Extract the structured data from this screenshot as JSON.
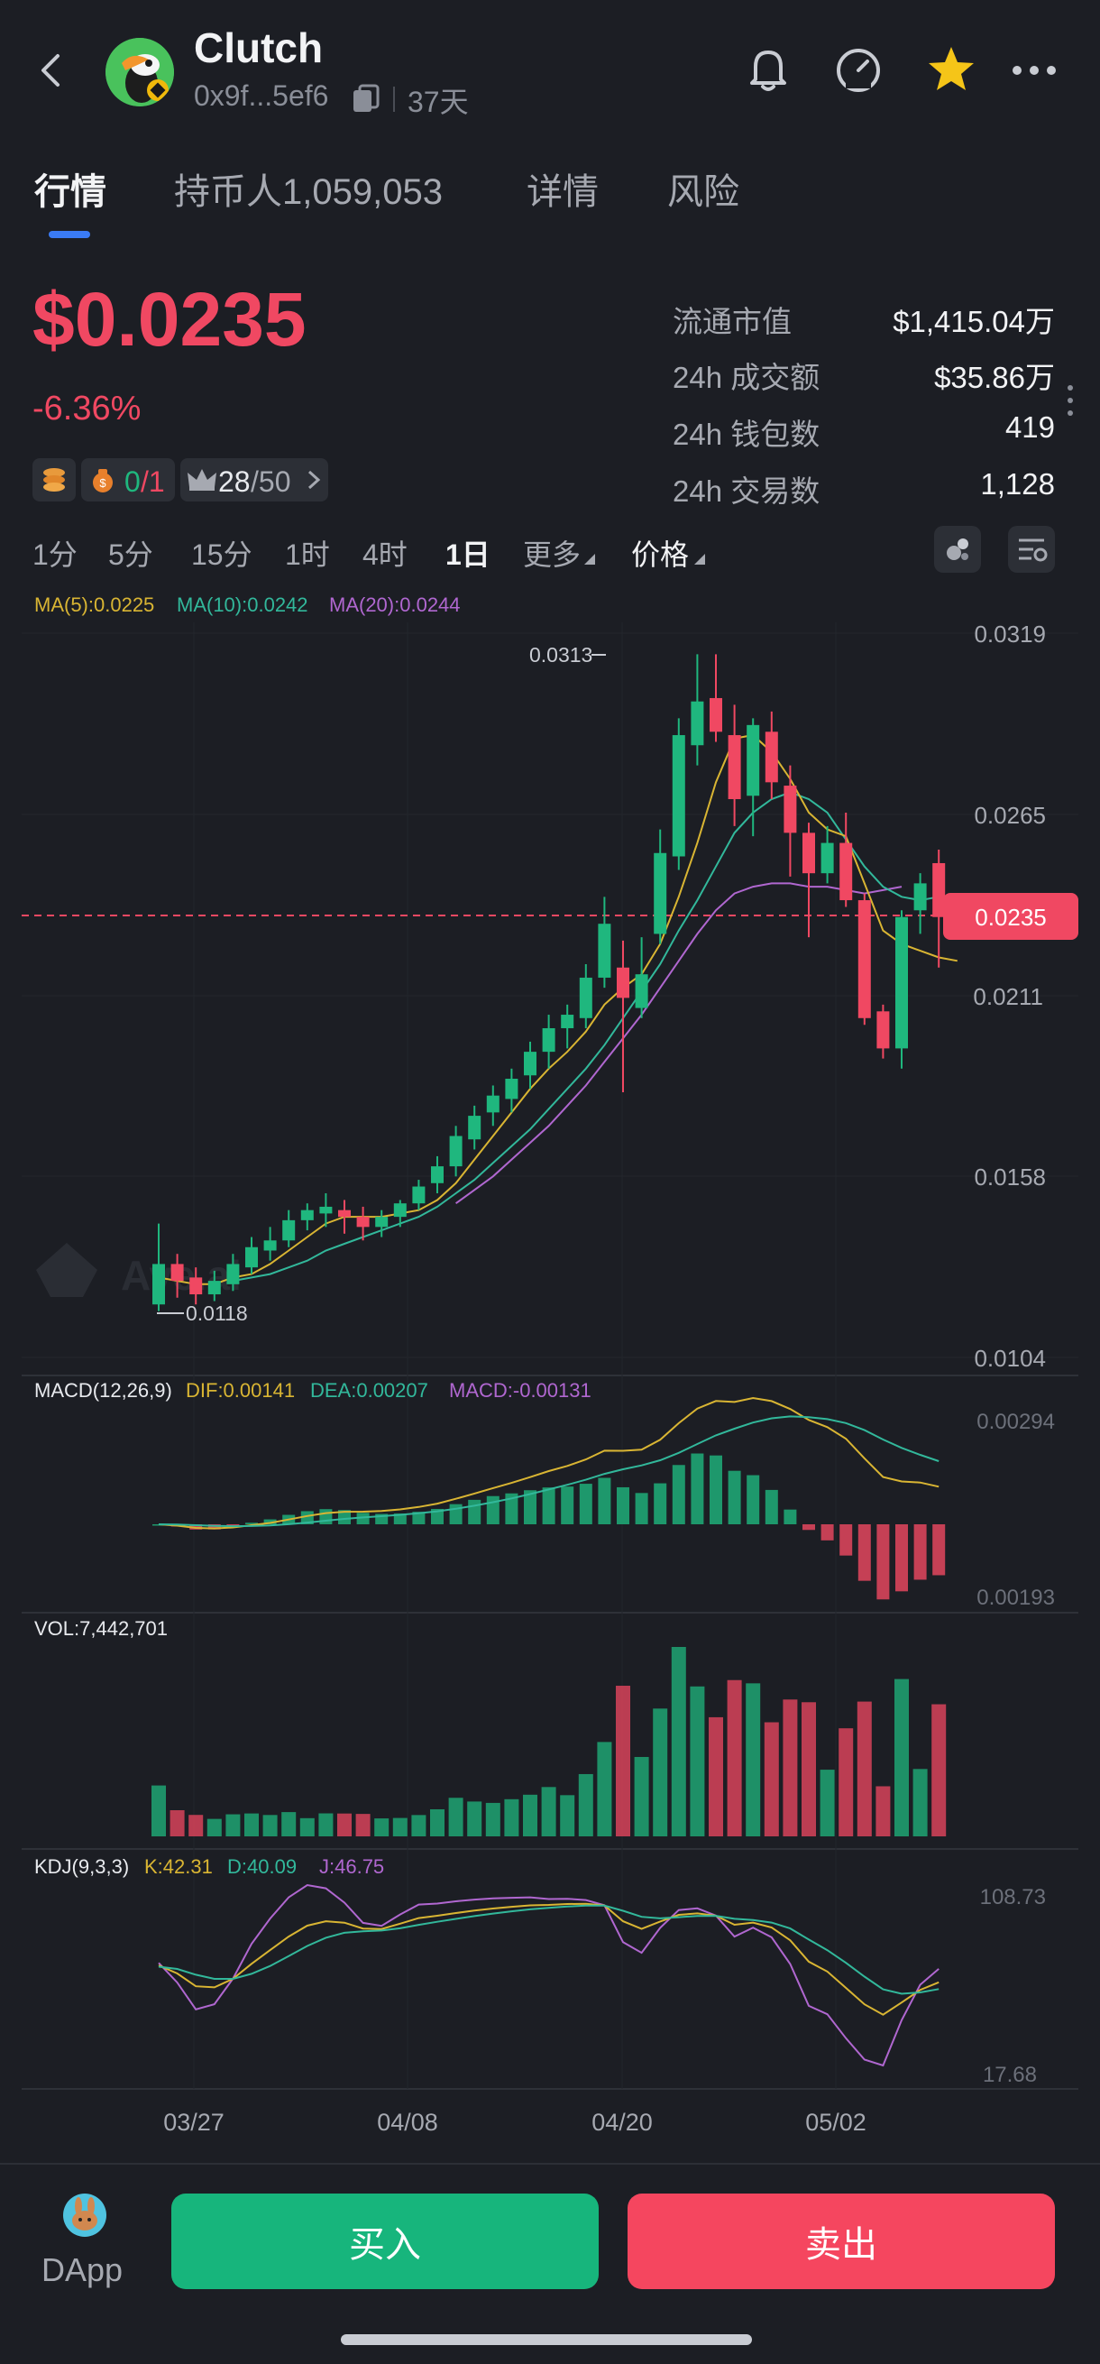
{
  "header": {
    "title": "Clutch",
    "address": "0x9f...5ef6",
    "age": "37天"
  },
  "tabs": [
    "行情",
    "持币人1,059,053",
    "详情",
    "风险"
  ],
  "price": {
    "value": "$0.0235",
    "change": "-6.36%",
    "badge_ratio_a": "0",
    "badge_ratio_b": "/1",
    "badge_rank": "28",
    "badge_rank_total": "/50"
  },
  "stats": [
    {
      "label": "流通市值",
      "value": "$1,415.04万"
    },
    {
      "label": "24h 成交额",
      "value": "$35.86万"
    },
    {
      "label": "24h 钱包数",
      "value": "419"
    },
    {
      "label": "24h 交易数",
      "value": "1,128"
    }
  ],
  "timeframes": [
    "1分",
    "5分",
    "15分",
    "1时",
    "4时",
    "1日",
    "更多",
    "价格"
  ],
  "active_timeframe": "1日",
  "colors": {
    "up": "#1fb77e",
    "down": "#f04862",
    "ma5": "#d9b533",
    "ma10": "#32b89b",
    "ma20": "#b067d0",
    "accent": "#3a7bf5"
  },
  "chart_data": [
    {
      "type": "candlestick",
      "title": "",
      "legend": [
        "MA(5):0.0225",
        "MA(10):0.0242",
        "MA(20):0.0244"
      ],
      "price_ticks": [
        "0.0319",
        "0.0265",
        "0.0211",
        "0.0158",
        "0.0104"
      ],
      "price_ylim": [
        0.0104,
        0.0319
      ],
      "current_price_label": "0.0235",
      "high_label": "0.0313",
      "low_label": "0.0118",
      "x_labels": [
        "03/27",
        "04/08",
        "04/20",
        "05/02"
      ],
      "candles": [
        [
          0.012,
          0.0132,
          0.0118,
          0.0144
        ],
        [
          0.0132,
          0.0127,
          0.0122,
          0.0135
        ],
        [
          0.0128,
          0.0123,
          0.012,
          0.0131
        ],
        [
          0.0123,
          0.0127,
          0.0121,
          0.013
        ],
        [
          0.0126,
          0.0132,
          0.0124,
          0.0135
        ],
        [
          0.0131,
          0.0137,
          0.0129,
          0.014
        ],
        [
          0.0136,
          0.0139,
          0.0133,
          0.0143
        ],
        [
          0.0139,
          0.0145,
          0.0137,
          0.0148
        ],
        [
          0.0145,
          0.0148,
          0.0142,
          0.015
        ],
        [
          0.0147,
          0.0149,
          0.0143,
          0.0153
        ],
        [
          0.0148,
          0.0146,
          0.0141,
          0.0151
        ],
        [
          0.0146,
          0.0143,
          0.0139,
          0.0149
        ],
        [
          0.0143,
          0.0146,
          0.014,
          0.0148
        ],
        [
          0.0146,
          0.015,
          0.0143,
          0.0151
        ],
        [
          0.015,
          0.0155,
          0.0148,
          0.0157
        ],
        [
          0.0156,
          0.0161,
          0.0153,
          0.0164
        ],
        [
          0.0161,
          0.017,
          0.0158,
          0.0173
        ],
        [
          0.0169,
          0.0176,
          0.0166,
          0.0179
        ],
        [
          0.0177,
          0.0182,
          0.0173,
          0.0185
        ],
        [
          0.0181,
          0.0187,
          0.0177,
          0.019
        ],
        [
          0.0188,
          0.0195,
          0.0184,
          0.0198
        ],
        [
          0.0195,
          0.0202,
          0.019,
          0.0206
        ],
        [
          0.0202,
          0.0206,
          0.0196,
          0.0209
        ],
        [
          0.0205,
          0.0217,
          0.0202,
          0.0221
        ],
        [
          0.0217,
          0.0233,
          0.0214,
          0.0241
        ],
        [
          0.022,
          0.0211,
          0.0183,
          0.0228
        ],
        [
          0.0208,
          0.0218,
          0.0205,
          0.0229
        ],
        [
          0.023,
          0.0254,
          0.0227,
          0.0261
        ],
        [
          0.0253,
          0.0289,
          0.0249,
          0.0294
        ],
        [
          0.0286,
          0.0299,
          0.028,
          0.0313
        ],
        [
          0.03,
          0.029,
          0.0287,
          0.0313
        ],
        [
          0.0289,
          0.027,
          0.0262,
          0.0298
        ],
        [
          0.0271,
          0.0292,
          0.0259,
          0.0294
        ],
        [
          0.029,
          0.0275,
          0.027,
          0.0296
        ],
        [
          0.0274,
          0.026,
          0.0247,
          0.028
        ],
        [
          0.026,
          0.0248,
          0.0229,
          0.0263
        ],
        [
          0.0248,
          0.0257,
          0.0245,
          0.0262
        ],
        [
          0.0257,
          0.024,
          0.0238,
          0.0266
        ],
        [
          0.024,
          0.0205,
          0.0203,
          0.0242
        ],
        [
          0.0207,
          0.0196,
          0.0193,
          0.0209
        ],
        [
          0.0196,
          0.0235,
          0.019,
          0.0237
        ],
        [
          0.0237,
          0.0245,
          0.023,
          0.0248
        ],
        [
          0.0251,
          0.0235,
          0.022,
          0.0255
        ]
      ],
      "ma5": [
        0.0128,
        0.0127,
        0.0126,
        0.0126,
        0.0128,
        0.0129,
        0.0132,
        0.0136,
        0.014,
        0.0144,
        0.0146,
        0.0146,
        0.0146,
        0.0147,
        0.0148,
        0.0151,
        0.0156,
        0.0163,
        0.017,
        0.0177,
        0.0184,
        0.019,
        0.0195,
        0.0201,
        0.0209,
        0.0214,
        0.0218,
        0.0227,
        0.0241,
        0.0257,
        0.0275,
        0.0288,
        0.0289,
        0.0284,
        0.0276,
        0.0266,
        0.0261,
        0.0259,
        0.0245,
        0.0231,
        0.0227,
        0.0225,
        0.0223,
        0.0222
      ],
      "ma10": [
        null,
        null,
        null,
        null,
        0.0127,
        0.0128,
        0.0129,
        0.0131,
        0.0133,
        0.0136,
        0.0138,
        0.014,
        0.0142,
        0.0144,
        0.0146,
        0.0149,
        0.0153,
        0.0157,
        0.0162,
        0.0167,
        0.0172,
        0.0178,
        0.0184,
        0.019,
        0.0197,
        0.0205,
        0.0213,
        0.0221,
        0.0231,
        0.024,
        0.025,
        0.026,
        0.0266,
        0.027,
        0.0272,
        0.027,
        0.0266,
        0.0258,
        0.025,
        0.0244,
        0.0241,
        0.024,
        0.0241
      ],
      "ma20": [
        null,
        null,
        null,
        null,
        null,
        null,
        null,
        null,
        null,
        null,
        null,
        null,
        null,
        null,
        null,
        null,
        0.015,
        0.0154,
        0.0158,
        0.0163,
        0.0168,
        0.0173,
        0.0179,
        0.0185,
        0.0192,
        0.0199,
        0.0206,
        0.0214,
        0.0222,
        0.023,
        0.0237,
        0.0242,
        0.0244,
        0.0245,
        0.0245,
        0.0244,
        0.0244,
        0.0243,
        0.0242,
        0.0243,
        0.0244
      ],
      "macd": {
        "legend": [
          "MACD(12,26,9)",
          "DIF:0.00141",
          "DEA:0.00207",
          "MACD:-0.00131"
        ],
        "axis_labels": [
          "0.00294",
          "0.00193"
        ]
      },
      "volume": {
        "legend": "VOL:7,442,701"
      },
      "kdj": {
        "legend": [
          "KDJ(9,3,3)",
          "K:42.31",
          "D:40.09",
          "J:46.75"
        ],
        "axis_labels": [
          "108.73",
          "17.68"
        ]
      }
    }
  ],
  "bottom": {
    "dapp_label": "DApp",
    "buy_label": "买入",
    "sell_label": "卖出"
  }
}
